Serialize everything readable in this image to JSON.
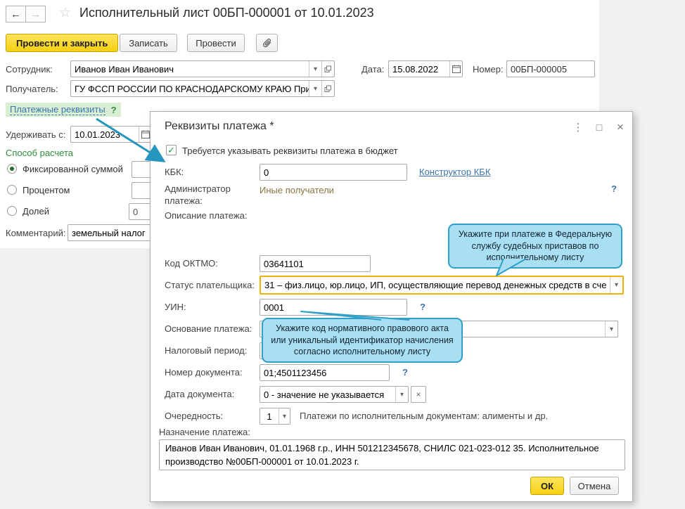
{
  "header": {
    "back": "←",
    "forward": "→",
    "star": "☆",
    "title": "Исполнительный лист 00БП-000001 от 10.01.2023"
  },
  "toolbar": {
    "post_and_close": "Провести и закрыть",
    "write": "Записать",
    "post": "Провести"
  },
  "form": {
    "employee_label": "Сотрудник:",
    "employee_value": "Иванов Иван Иванович",
    "date_label": "Дата:",
    "date_value": "15.08.2022",
    "number_label": "Номер:",
    "number_value": "00БП-000005",
    "recipient_label": "Получатель:",
    "recipient_value": "ГУ ФССП РОССИИ ПО КРАСНОДАРСКОМУ КРАЮ Примс",
    "payment_details_link": "Платежные реквизиты",
    "payment_details_help": "?",
    "withhold_label": "Удерживать с:",
    "withhold_value": "10.01.2023",
    "calc_method_title": "Способ расчета",
    "calc_fixed": "Фиксированной суммой",
    "calc_percent": "Процентом",
    "calc_share": "Долей",
    "calc_share_value": "0",
    "comment_label": "Комментарий:",
    "comment_value": "земельный налог"
  },
  "dialog": {
    "title": "Реквизиты платежа *",
    "menu_icon": "⋮",
    "maximize_icon": "□",
    "close_icon": "×",
    "check_glyph": "✓",
    "require_checkbox": "Требуется указывать реквизиты платежа в бюджет",
    "kbk_label": "КБК:",
    "kbk_value": "0",
    "kbk_link": "Конструктор КБК",
    "admin_label": "Администратор платежа:",
    "admin_value": "Иные получатели",
    "descr_label": "Описание платежа:",
    "oktmo_label": "Код ОКТМО:",
    "oktmo_value": "03641101",
    "status_label": "Статус плательщика:",
    "status_value": "31 – физ.лицо, юр.лицо, ИП, осуществляющие перевод денежных средств в сче",
    "uin_label": "УИН:",
    "uin_value": "0001",
    "basis_label": "Основание платежа:",
    "basis_value": "0",
    "period_label": "Налоговый период:",
    "period_value": "0",
    "docnum_label": "Номер документа:",
    "docnum_value": "01;4501123456",
    "docdate_label": "Дата документа:",
    "docdate_value": "0 - значение не указывается",
    "docdate_clear": "×",
    "priority_label": "Очередность:",
    "priority_value": "1",
    "priority_note": "Платежи по исполнительным документам: алименты и др.",
    "purpose_label": "Назначение платежа:",
    "purpose_value": "Иванов Иван Иванович, 01.01.1968 г.р., ИНН 501212345678, СНИЛС 021-023-012 35. Исполнительное производство №00БП-000001 от 10.01.2023 г.",
    "ok": "ОК",
    "cancel": "Отмена",
    "help_mark": "?",
    "dropdown_glyph": "▾"
  },
  "annotations": {
    "tooltip_fssp": "Укажите при платеже в Федеральную службу судебных приставов по исполнительному листу",
    "tooltip_uin": "Укажите код нормативного правового акта или уникальный идентификатор начисления согласно исполнительному листу"
  },
  "colors": {
    "accent_yellow": "#f5d012",
    "link_blue": "#3b74ad",
    "tooltip_bg": "#a8dff3",
    "tooltip_border": "#30a0c8",
    "highlight_orange": "#ecb200",
    "annotation_teal": "#2596be",
    "green": "#2e8b3c",
    "olive_value": "#8a7540"
  }
}
